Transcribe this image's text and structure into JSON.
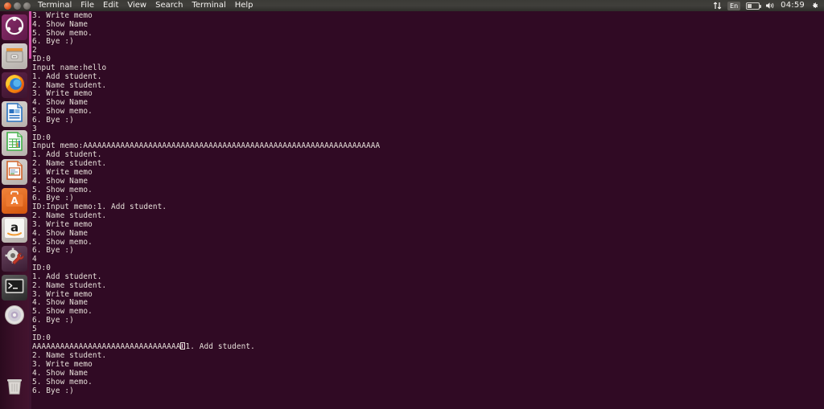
{
  "panel": {
    "window_buttons": [
      "close",
      "minimize",
      "maximize"
    ],
    "menus": [
      "Terminal",
      "File",
      "Edit",
      "View",
      "Search",
      "Terminal",
      "Help"
    ],
    "tray": {
      "network_icon": "network-updown-icon",
      "keyboard_layout": "En",
      "battery_icon": "battery-icon",
      "volume_icon": "volume-icon",
      "clock": "04:59",
      "settings_icon": "gear-icon"
    }
  },
  "launcher": {
    "items": [
      {
        "name": "ubuntu-dash-home",
        "icon": "ubuntu-logo-icon",
        "running": false
      },
      {
        "name": "files",
        "icon": "file-manager-icon",
        "running": false
      },
      {
        "name": "firefox",
        "icon": "firefox-icon",
        "running": false
      },
      {
        "name": "libreoffice-writer",
        "icon": "writer-icon",
        "running": false
      },
      {
        "name": "libreoffice-calc",
        "icon": "calc-icon",
        "running": false
      },
      {
        "name": "libreoffice-impress",
        "icon": "impress-icon",
        "running": false
      },
      {
        "name": "ubuntu-software",
        "icon": "ubuntu-software-icon",
        "running": false
      },
      {
        "name": "amazon",
        "icon": "amazon-icon",
        "running": false
      },
      {
        "name": "system-settings",
        "icon": "gear-wrench-icon",
        "running": false
      },
      {
        "name": "terminal",
        "icon": "terminal-icon",
        "running": true
      },
      {
        "name": "disc-burner",
        "icon": "cd-disc-icon",
        "running": false
      }
    ],
    "trash": {
      "name": "trash",
      "icon": "trash-icon"
    }
  },
  "terminal": {
    "scrollbar": {
      "thumb_position_pct": 0,
      "thumb_size_pct": 12
    },
    "lines": [
      "3. Write memo",
      "4. Show Name",
      "5. Show memo.",
      "6. Bye :)",
      "2",
      "ID:0",
      "Input name:hello",
      "1. Add student.",
      "2. Name student.",
      "3. Write memo",
      "4. Show Name",
      "5. Show memo.",
      "6. Bye :)",
      "3",
      "ID:0",
      "Input memo:AAAAAAAAAAAAAAAAAAAAAAAAAAAAAAAAAAAAAAAAAAAAAAAAAAAAAAAAAAAAAAAA",
      "1. Add student.",
      "2. Name student.",
      "3. Write memo",
      "4. Show Name",
      "5. Show memo.",
      "6. Bye :)",
      "ID:Input memo:1. Add student.",
      "2. Name student.",
      "3. Write memo",
      "4. Show Name",
      "5. Show memo.",
      "6. Bye :)",
      "4",
      "ID:0",
      "1. Add student.",
      "2. Name student.",
      "3. Write memo",
      "4. Show Name",
      "5. Show memo.",
      "6. Bye :)",
      "5",
      "ID:0"
    ],
    "cursor_line": {
      "before": "AAAAAAAAAAAAAAAAAAAAAAAAAAAAAAAA",
      "cursor": "block-cursor",
      "after": "1. Add student."
    },
    "lines_after_cursor": [
      "2. Name student.",
      "3. Write memo",
      "4. Show Name",
      "5. Show memo.",
      "6. Bye :)"
    ],
    "colors": {
      "background": "#300a24",
      "foreground": "#e7e0da",
      "scrollbar_thumb": "#d34fa8"
    }
  }
}
